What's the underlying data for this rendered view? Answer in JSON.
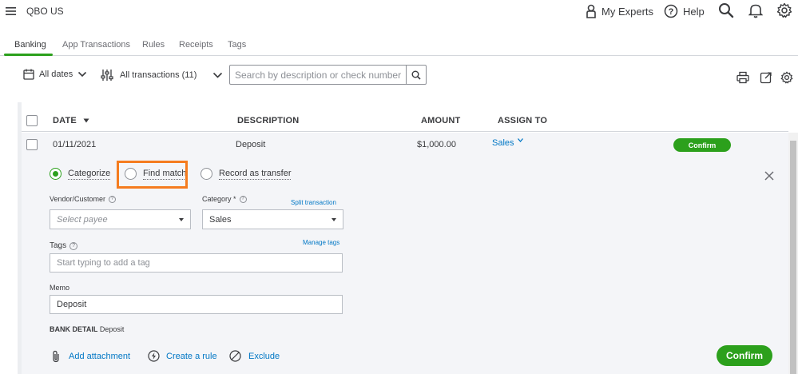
{
  "app": {
    "company_name": "QBO US"
  },
  "top_nav": {
    "my_experts": "My Experts",
    "help": "Help",
    "icons": [
      "menu-icon",
      "person-icon",
      "help-icon",
      "search-icon",
      "bell-icon",
      "gear-icon"
    ]
  },
  "tabs": [
    {
      "label": "Banking",
      "active": true
    },
    {
      "label": "App Transactions",
      "active": false
    },
    {
      "label": "Rules",
      "active": false
    },
    {
      "label": "Receipts",
      "active": false
    },
    {
      "label": "Tags",
      "active": false
    }
  ],
  "toolbar": {
    "date_filter": "All dates",
    "transactions_filter": "All transactions (11)",
    "search_placeholder": "Search by description or check number"
  },
  "table": {
    "columns": {
      "date": "DATE",
      "description": "DESCRIPTION",
      "amount": "AMOUNT",
      "assign_to": "ASSIGN TO"
    },
    "row": {
      "date": "01/11/2021",
      "description": "Deposit",
      "amount": "$1,000.00",
      "assign_to": "Sales",
      "confirm_label": "Confirm"
    }
  },
  "detail": {
    "options": {
      "categorize": "Categorize",
      "find_match": "Find match",
      "record_transfer": "Record as transfer"
    },
    "selected_option": "Categorize",
    "vendor_label": "Vendor/Customer",
    "vendor_placeholder": "Select payee",
    "category_label": "Category *",
    "split_link": "Split transaction",
    "category_value": "Sales",
    "tags_label": "Tags",
    "manage_tags": "Manage tags",
    "tags_placeholder": "Start typing to add a tag",
    "memo_label": "Memo",
    "memo_value": "Deposit",
    "bank_detail_label": "BANK DETAIL",
    "bank_detail_value": "Deposit",
    "add_attachment": "Add attachment",
    "create_rule": "Create a rule",
    "exclude": "Exclude",
    "confirm_label": "Confirm"
  },
  "colors": {
    "accent_green": "#2ca01c",
    "link_blue": "#0077c5",
    "highlight_orange": "#f57c1f"
  }
}
